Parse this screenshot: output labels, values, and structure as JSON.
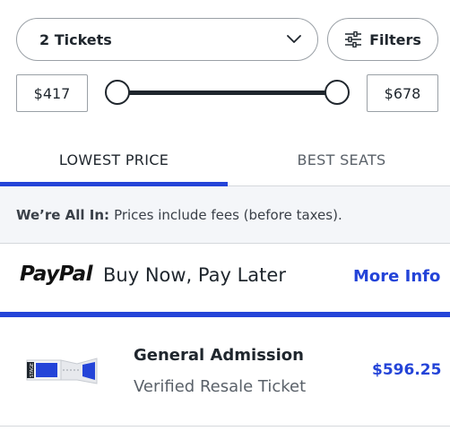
{
  "quantity": {
    "selected": "2 Tickets"
  },
  "filters": {
    "label": "Filters"
  },
  "price_range": {
    "min_label": "$417",
    "max_label": "$678"
  },
  "tabs": [
    {
      "label": "LOWEST PRICE",
      "active": true
    },
    {
      "label": "BEST SEATS",
      "active": false
    }
  ],
  "notice": {
    "bold": "We’re All In:",
    "text": "Prices include fees (before taxes)."
  },
  "promo": {
    "brand": "PayPal",
    "text": "Buy Now, Pay Later",
    "link": "More Info"
  },
  "listing": {
    "section": "General Admission",
    "type": "Verified Resale Ticket",
    "price": "$596.25",
    "ticket_text": "STAGE"
  },
  "colors": {
    "accent": "#2444d8",
    "text": "#1f262d",
    "muted": "#5a6169",
    "notice_bg": "#f4f6f9"
  },
  "icons": {
    "dropdown": "chevron-down-icon",
    "filters": "sliders-icon",
    "ticket": "ticket-icon"
  }
}
